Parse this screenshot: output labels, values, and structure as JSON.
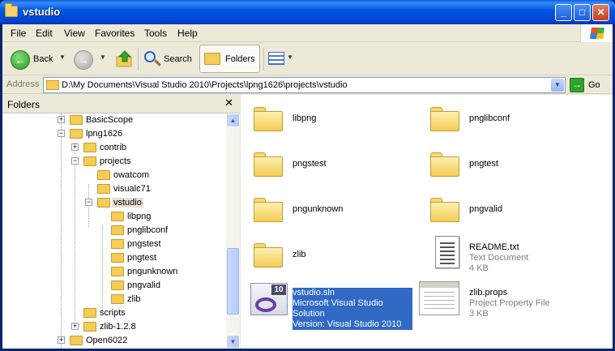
{
  "window": {
    "title": "vstudio"
  },
  "menu": [
    "File",
    "Edit",
    "View",
    "Favorites",
    "Tools",
    "Help"
  ],
  "toolbar": {
    "back": "Back",
    "search": "Search",
    "folders": "Folders"
  },
  "address": {
    "label": "Address",
    "path": "D:\\My Documents\\Visual Studio 2010\\Projects\\lpng1626\\projects\\vstudio",
    "go": "Go"
  },
  "folders_pane": {
    "title": "Folders",
    "tree": [
      "BasicScope",
      "lpng1626",
      "contrib",
      "projects",
      "owatcom",
      "visualc71",
      "vstudio",
      "libpng",
      "pnglibconf",
      "pngstest",
      "pngtest",
      "pngunknown",
      "pngvalid",
      "zlib",
      "scripts",
      "zlib-1.2.8",
      "Open6022"
    ]
  },
  "files": [
    {
      "name": "libpng",
      "type": "folder"
    },
    {
      "name": "pnglibconf",
      "type": "folder"
    },
    {
      "name": "pngstest",
      "type": "folder"
    },
    {
      "name": "pngtest",
      "type": "folder"
    },
    {
      "name": "pngunknown",
      "type": "folder"
    },
    {
      "name": "pngvalid",
      "type": "folder"
    },
    {
      "name": "zlib",
      "type": "folder"
    },
    {
      "name": "README.txt",
      "type": "Text Document",
      "size": "4 KB"
    },
    {
      "name": "vstudio.sln",
      "type": "Microsoft Visual Studio Solution",
      "size": "Version: Visual Studio 2010",
      "badge": "10"
    },
    {
      "name": "zlib.props",
      "type": "Project Property File",
      "size": "3 KB"
    }
  ],
  "colors": {
    "titlebar": "#0058e6",
    "selection": "#316ac5",
    "chrome": "#ece9d8"
  }
}
